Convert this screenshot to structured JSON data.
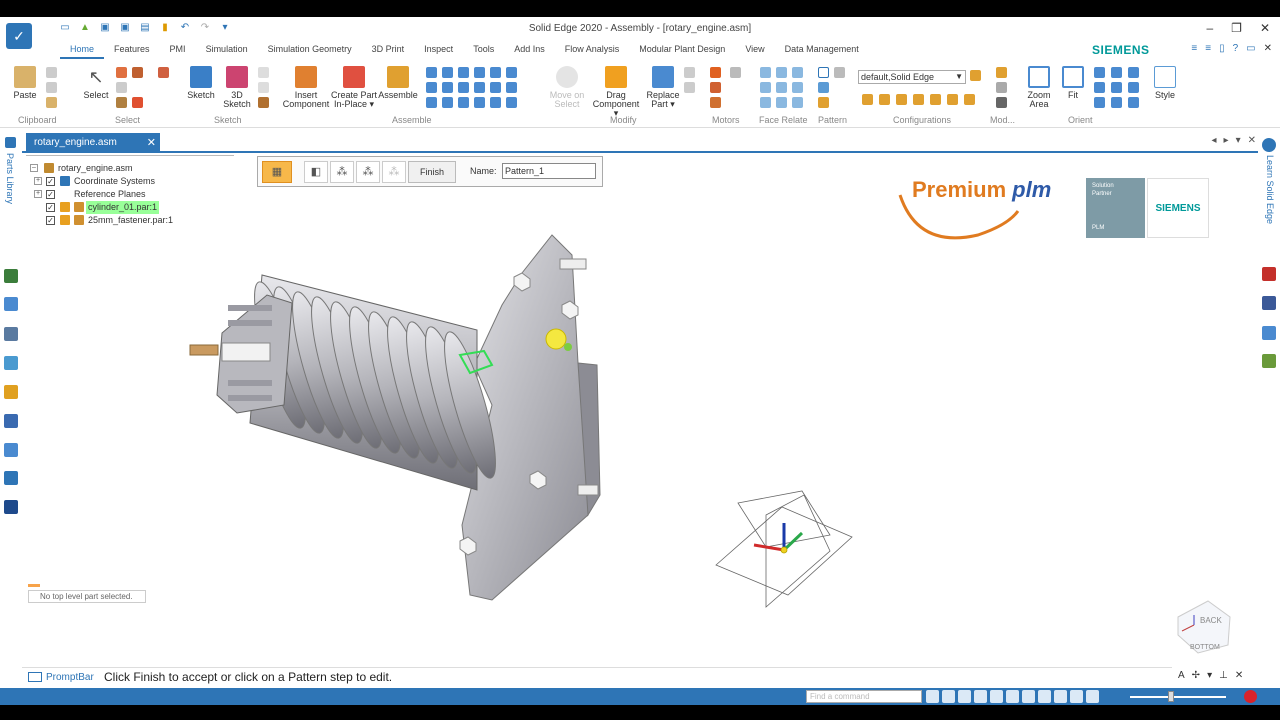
{
  "window": {
    "title": "Solid Edge 2020 - Assembly - [rotary_engine.asm]",
    "brand": "SIEMENS"
  },
  "ribbon_tabs": [
    "Home",
    "Features",
    "PMI",
    "Simulation",
    "Simulation Geometry",
    "3D Print",
    "Inspect",
    "Tools",
    "Add Ins",
    "Flow Analysis",
    "Modular Plant Design",
    "View",
    "Data Management"
  ],
  "ribbon": {
    "paste": "Paste",
    "select": "Select",
    "sketch": "Sketch",
    "sketch3d_1": "3D",
    "sketch3d_2": "Sketch",
    "insert_component_1": "Insert",
    "insert_component_2": "Component",
    "create_part_1": "Create Part",
    "create_part_2": "In-Place ▾",
    "assemble": "Assemble",
    "move_on_select_1": "Move on",
    "move_on_select_2": "Select",
    "drag_component_1": "Drag",
    "drag_component_2": "Component ▾",
    "replace_part_1": "Replace",
    "replace_part_2": "Part ▾",
    "configuration_value": "default,Solid Edge",
    "zoom_area_1": "Zoom",
    "zoom_area_2": "Area",
    "fit": "Fit",
    "style": "Style",
    "groups": {
      "clipboard": "Clipboard",
      "select": "Select",
      "sketch": "Sketch",
      "assemble": "Assemble",
      "modify": "Modify",
      "motors": "Motors",
      "face_relate": "Face Relate",
      "pattern": "Pattern",
      "configurations": "Configurations",
      "model": "Mod...",
      "orient": "Orient"
    }
  },
  "document_tab": "rotary_engine.asm",
  "left_strip_label": "Parts Library",
  "right_strip_label": "Learn Solid Edge",
  "tree": {
    "root": "rotary_engine.asm",
    "items": [
      {
        "label": "Coordinate Systems"
      },
      {
        "label": "Reference Planes"
      },
      {
        "label": "cylinder_01.par:1"
      },
      {
        "label": "25mm_fastener.par:1"
      }
    ]
  },
  "command_bar": {
    "finish": "Finish",
    "name_label": "Name:",
    "name_value": "Pattern_1"
  },
  "logos": {
    "premium": "Premium",
    "plm": "plm",
    "partner_1": "Solution",
    "partner_2": "Partner",
    "partner_3": "PLM",
    "siemens": "SIEMENS"
  },
  "status_message": "No top level part selected.",
  "prompt": {
    "label": "PromptBar",
    "text": "Click Finish to accept or click on a Pattern step to edit."
  },
  "statusbar": {
    "find_placeholder": "Find a command"
  },
  "view_cube": {
    "back": "BACK",
    "bottom": "BOTTOM"
  }
}
